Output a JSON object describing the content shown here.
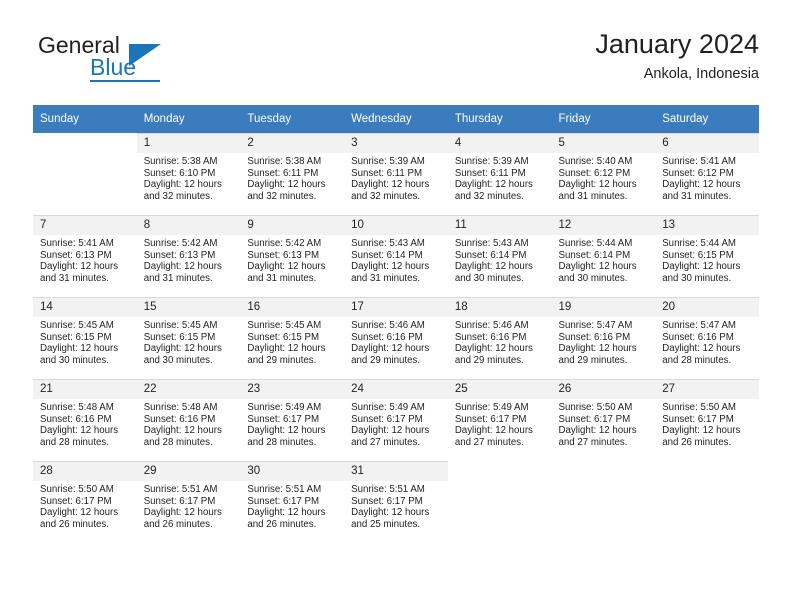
{
  "brand": {
    "name_top": "General",
    "name_bottom": "Blue",
    "accent_color": "#1b75bb"
  },
  "header": {
    "title": "January 2024",
    "subtitle": "Ankola, Indonesia"
  },
  "calendar": {
    "header_bg": "#3a7cbe",
    "daynum_bg": "#f2f2f2",
    "weekdays": [
      "Sunday",
      "Monday",
      "Tuesday",
      "Wednesday",
      "Thursday",
      "Friday",
      "Saturday"
    ],
    "labels": {
      "sunrise_prefix": "Sunrise: ",
      "sunset_prefix": "Sunset: ",
      "daylight_prefix": "Daylight: "
    },
    "weeks": [
      [
        {
          "empty": true
        },
        {
          "day": "1",
          "sunrise": "Sunrise: 5:38 AM",
          "sunset": "Sunset: 6:10 PM",
          "daylight": "Daylight: 12 hours and 32 minutes."
        },
        {
          "day": "2",
          "sunrise": "Sunrise: 5:38 AM",
          "sunset": "Sunset: 6:11 PM",
          "daylight": "Daylight: 12 hours and 32 minutes."
        },
        {
          "day": "3",
          "sunrise": "Sunrise: 5:39 AM",
          "sunset": "Sunset: 6:11 PM",
          "daylight": "Daylight: 12 hours and 32 minutes."
        },
        {
          "day": "4",
          "sunrise": "Sunrise: 5:39 AM",
          "sunset": "Sunset: 6:11 PM",
          "daylight": "Daylight: 12 hours and 32 minutes."
        },
        {
          "day": "5",
          "sunrise": "Sunrise: 5:40 AM",
          "sunset": "Sunset: 6:12 PM",
          "daylight": "Daylight: 12 hours and 31 minutes."
        },
        {
          "day": "6",
          "sunrise": "Sunrise: 5:41 AM",
          "sunset": "Sunset: 6:12 PM",
          "daylight": "Daylight: 12 hours and 31 minutes."
        }
      ],
      [
        {
          "day": "7",
          "sunrise": "Sunrise: 5:41 AM",
          "sunset": "Sunset: 6:13 PM",
          "daylight": "Daylight: 12 hours and 31 minutes."
        },
        {
          "day": "8",
          "sunrise": "Sunrise: 5:42 AM",
          "sunset": "Sunset: 6:13 PM",
          "daylight": "Daylight: 12 hours and 31 minutes."
        },
        {
          "day": "9",
          "sunrise": "Sunrise: 5:42 AM",
          "sunset": "Sunset: 6:13 PM",
          "daylight": "Daylight: 12 hours and 31 minutes."
        },
        {
          "day": "10",
          "sunrise": "Sunrise: 5:43 AM",
          "sunset": "Sunset: 6:14 PM",
          "daylight": "Daylight: 12 hours and 31 minutes."
        },
        {
          "day": "11",
          "sunrise": "Sunrise: 5:43 AM",
          "sunset": "Sunset: 6:14 PM",
          "daylight": "Daylight: 12 hours and 30 minutes."
        },
        {
          "day": "12",
          "sunrise": "Sunrise: 5:44 AM",
          "sunset": "Sunset: 6:14 PM",
          "daylight": "Daylight: 12 hours and 30 minutes."
        },
        {
          "day": "13",
          "sunrise": "Sunrise: 5:44 AM",
          "sunset": "Sunset: 6:15 PM",
          "daylight": "Daylight: 12 hours and 30 minutes."
        }
      ],
      [
        {
          "day": "14",
          "sunrise": "Sunrise: 5:45 AM",
          "sunset": "Sunset: 6:15 PM",
          "daylight": "Daylight: 12 hours and 30 minutes."
        },
        {
          "day": "15",
          "sunrise": "Sunrise: 5:45 AM",
          "sunset": "Sunset: 6:15 PM",
          "daylight": "Daylight: 12 hours and 30 minutes."
        },
        {
          "day": "16",
          "sunrise": "Sunrise: 5:45 AM",
          "sunset": "Sunset: 6:15 PM",
          "daylight": "Daylight: 12 hours and 29 minutes."
        },
        {
          "day": "17",
          "sunrise": "Sunrise: 5:46 AM",
          "sunset": "Sunset: 6:16 PM",
          "daylight": "Daylight: 12 hours and 29 minutes."
        },
        {
          "day": "18",
          "sunrise": "Sunrise: 5:46 AM",
          "sunset": "Sunset: 6:16 PM",
          "daylight": "Daylight: 12 hours and 29 minutes."
        },
        {
          "day": "19",
          "sunrise": "Sunrise: 5:47 AM",
          "sunset": "Sunset: 6:16 PM",
          "daylight": "Daylight: 12 hours and 29 minutes."
        },
        {
          "day": "20",
          "sunrise": "Sunrise: 5:47 AM",
          "sunset": "Sunset: 6:16 PM",
          "daylight": "Daylight: 12 hours and 28 minutes."
        }
      ],
      [
        {
          "day": "21",
          "sunrise": "Sunrise: 5:48 AM",
          "sunset": "Sunset: 6:16 PM",
          "daylight": "Daylight: 12 hours and 28 minutes."
        },
        {
          "day": "22",
          "sunrise": "Sunrise: 5:48 AM",
          "sunset": "Sunset: 6:16 PM",
          "daylight": "Daylight: 12 hours and 28 minutes."
        },
        {
          "day": "23",
          "sunrise": "Sunrise: 5:49 AM",
          "sunset": "Sunset: 6:17 PM",
          "daylight": "Daylight: 12 hours and 28 minutes."
        },
        {
          "day": "24",
          "sunrise": "Sunrise: 5:49 AM",
          "sunset": "Sunset: 6:17 PM",
          "daylight": "Daylight: 12 hours and 27 minutes."
        },
        {
          "day": "25",
          "sunrise": "Sunrise: 5:49 AM",
          "sunset": "Sunset: 6:17 PM",
          "daylight": "Daylight: 12 hours and 27 minutes."
        },
        {
          "day": "26",
          "sunrise": "Sunrise: 5:50 AM",
          "sunset": "Sunset: 6:17 PM",
          "daylight": "Daylight: 12 hours and 27 minutes."
        },
        {
          "day": "27",
          "sunrise": "Sunrise: 5:50 AM",
          "sunset": "Sunset: 6:17 PM",
          "daylight": "Daylight: 12 hours and 26 minutes."
        }
      ],
      [
        {
          "day": "28",
          "sunrise": "Sunrise: 5:50 AM",
          "sunset": "Sunset: 6:17 PM",
          "daylight": "Daylight: 12 hours and 26 minutes."
        },
        {
          "day": "29",
          "sunrise": "Sunrise: 5:51 AM",
          "sunset": "Sunset: 6:17 PM",
          "daylight": "Daylight: 12 hours and 26 minutes."
        },
        {
          "day": "30",
          "sunrise": "Sunrise: 5:51 AM",
          "sunset": "Sunset: 6:17 PM",
          "daylight": "Daylight: 12 hours and 26 minutes."
        },
        {
          "day": "31",
          "sunrise": "Sunrise: 5:51 AM",
          "sunset": "Sunset: 6:17 PM",
          "daylight": "Daylight: 12 hours and 25 minutes."
        },
        {
          "empty": true
        },
        {
          "empty": true
        },
        {
          "empty": true
        }
      ]
    ]
  }
}
